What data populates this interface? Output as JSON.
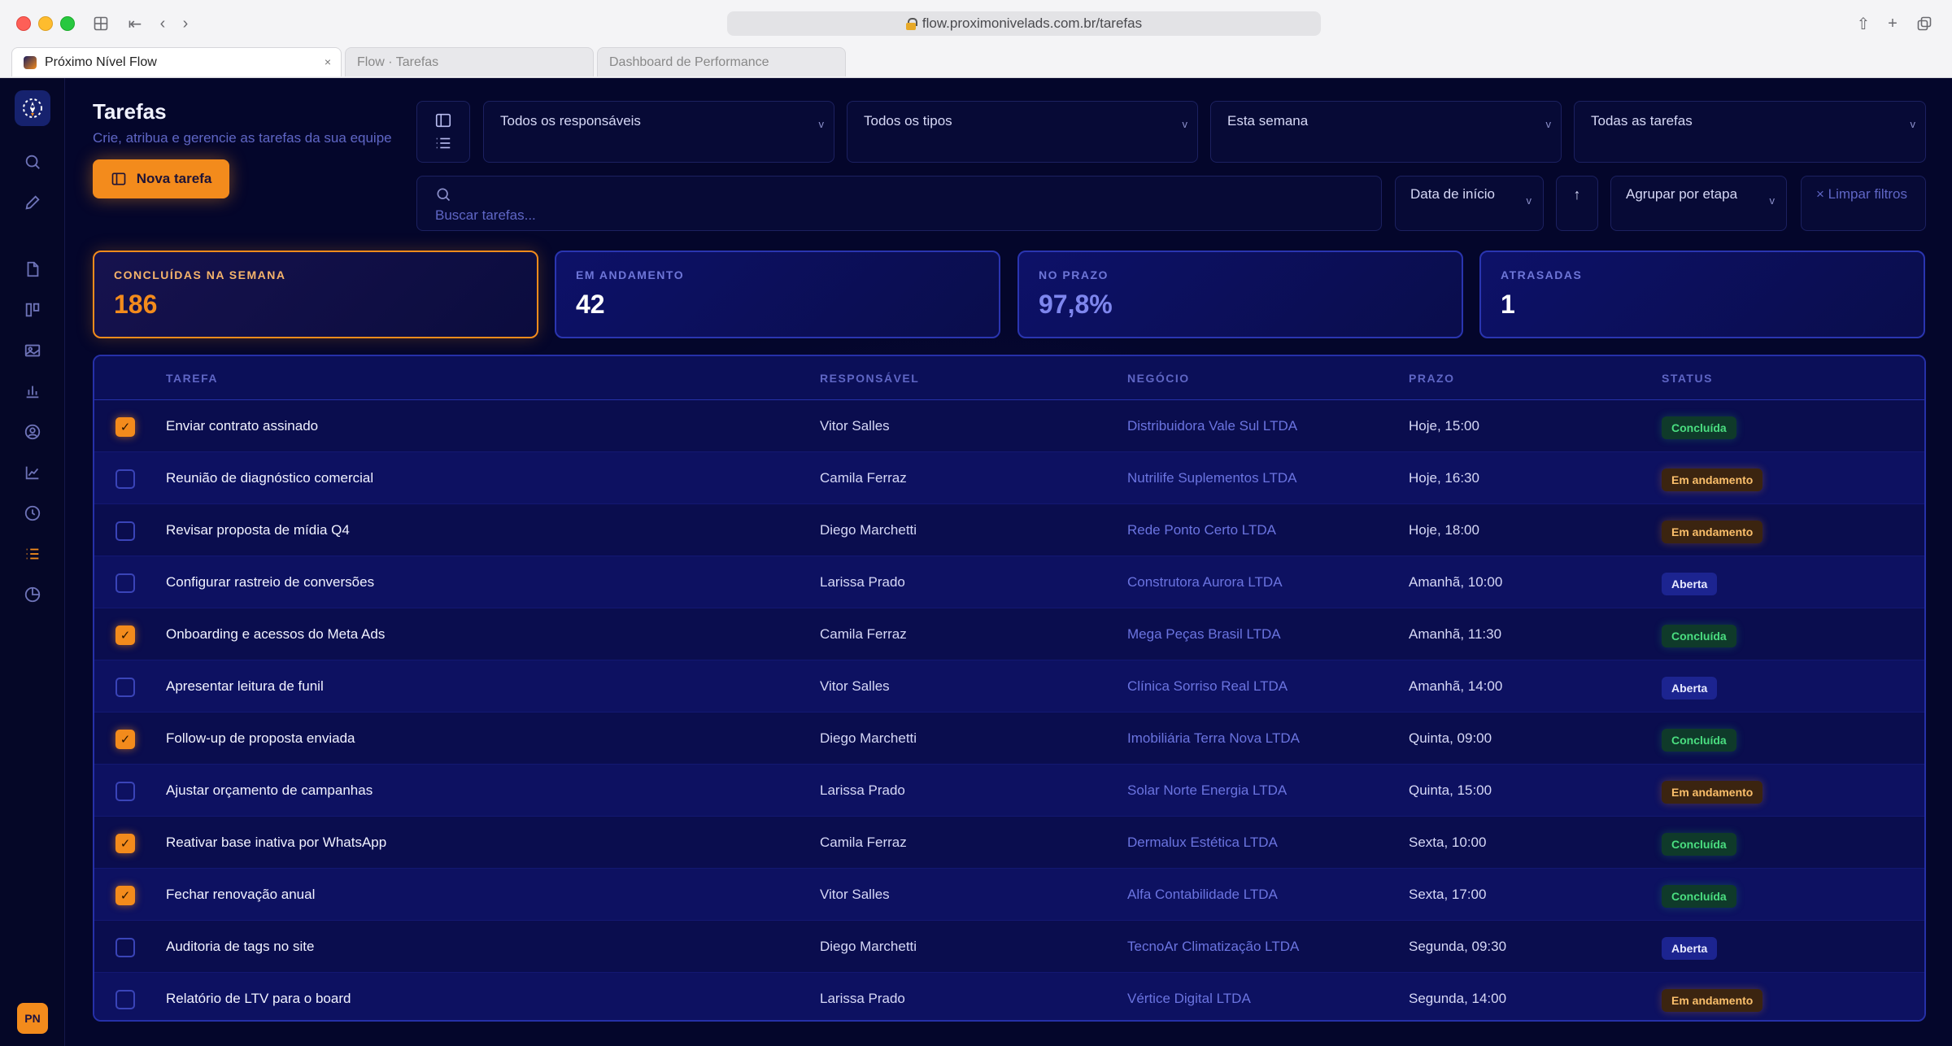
{
  "browser": {
    "url": "flow.proximonivelads.com.br/tarefas",
    "tabs": [
      {
        "label": "Próximo Nível Flow",
        "active": true
      },
      {
        "label": "Flow · Tarefas",
        "active": false
      },
      {
        "label": "Dashboard de Performance",
        "active": false
      }
    ]
  },
  "sidebar": {
    "items": [
      {
        "icon": "search-icon"
      },
      {
        "icon": "edit-icon"
      },
      {
        "icon": "file-icon"
      },
      {
        "icon": "board-icon"
      },
      {
        "icon": "image-icon"
      },
      {
        "icon": "bar-chart-icon"
      },
      {
        "icon": "user-circle-icon"
      },
      {
        "icon": "line-chart-icon"
      },
      {
        "icon": "clock-icon"
      },
      {
        "icon": "list-icon",
        "active": true
      },
      {
        "icon": "pie-chart-icon"
      }
    ],
    "avatar": "PN"
  },
  "header": {
    "title": "Tarefas",
    "subtitle": "Crie, atribua e gerencie as tarefas da sua equipe",
    "new_button": "Nova tarefa"
  },
  "filters": {
    "owner": "Todos os responsáveis",
    "type": "Todos os tipos",
    "period": "Esta semana",
    "scope": "Todas as tarefas",
    "search_placeholder": "Buscar tarefas...",
    "sort_by": "Data de início",
    "sort_dir": "↑",
    "group_by": "Agrupar por etapa",
    "clear": "× Limpar filtros"
  },
  "stats": [
    {
      "label": "CONCLUÍDAS NA SEMANA",
      "value": "186"
    },
    {
      "label": "EM ANDAMENTO",
      "value": "42"
    },
    {
      "label": "NO PRAZO",
      "value": "97,8%"
    },
    {
      "label": "ATRASADAS",
      "value": "1"
    }
  ],
  "table": {
    "columns": [
      "TAREFA",
      "RESPONSÁVEL",
      "NEGÓCIO",
      "PRAZO",
      "STATUS"
    ],
    "rows": [
      {
        "done": true,
        "task": "Enviar contrato assinado",
        "owner": "Vitor Salles",
        "business": "Distribuidora Vale Sul LTDA",
        "due": "Hoje, 15:00",
        "status": "Concluída",
        "kind": "done"
      },
      {
        "done": false,
        "task": "Reunião de diagnóstico comercial",
        "owner": "Camila Ferraz",
        "business": "Nutrilife Suplementos LTDA",
        "due": "Hoje, 16:30",
        "status": "Em andamento",
        "kind": "prog"
      },
      {
        "done": false,
        "task": "Revisar proposta de mídia Q4",
        "owner": "Diego Marchetti",
        "business": "Rede Ponto Certo LTDA",
        "due": "Hoje, 18:00",
        "status": "Em andamento",
        "kind": "prog"
      },
      {
        "done": false,
        "task": "Configurar rastreio de conversões",
        "owner": "Larissa Prado",
        "business": "Construtora Aurora LTDA",
        "due": "Amanhã, 10:00",
        "status": "Aberta",
        "kind": "open"
      },
      {
        "done": true,
        "task": "Onboarding e acessos do Meta Ads",
        "owner": "Camila Ferraz",
        "business": "Mega Peças Brasil LTDA",
        "due": "Amanhã, 11:30",
        "status": "Concluída",
        "kind": "done"
      },
      {
        "done": false,
        "task": "Apresentar leitura de funil",
        "owner": "Vitor Salles",
        "business": "Clínica Sorriso Real LTDA",
        "due": "Amanhã, 14:00",
        "status": "Aberta",
        "kind": "open"
      },
      {
        "done": true,
        "task": "Follow-up de proposta enviada",
        "owner": "Diego Marchetti",
        "business": "Imobiliária Terra Nova LTDA",
        "due": "Quinta, 09:00",
        "status": "Concluída",
        "kind": "done"
      },
      {
        "done": false,
        "task": "Ajustar orçamento de campanhas",
        "owner": "Larissa Prado",
        "business": "Solar Norte Energia LTDA",
        "due": "Quinta, 15:00",
        "status": "Em andamento",
        "kind": "prog"
      },
      {
        "done": true,
        "task": "Reativar base inativa por WhatsApp",
        "owner": "Camila Ferraz",
        "business": "Dermalux Estética LTDA",
        "due": "Sexta, 10:00",
        "status": "Concluída",
        "kind": "done"
      },
      {
        "done": true,
        "task": "Fechar renovação anual",
        "owner": "Vitor Salles",
        "business": "Alfa Contabilidade LTDA",
        "due": "Sexta, 17:00",
        "status": "Concluída",
        "kind": "done"
      },
      {
        "done": false,
        "task": "Auditoria de tags no site",
        "owner": "Diego Marchetti",
        "business": "TecnoAr Climatização LTDA",
        "due": "Segunda, 09:30",
        "status": "Aberta",
        "kind": "open"
      },
      {
        "done": false,
        "task": "Relatório de LTV para o board",
        "owner": "Larissa Prado",
        "business": "Vértice Digital LTDA",
        "due": "Segunda, 14:00",
        "status": "Em andamento",
        "kind": "prog"
      }
    ]
  },
  "colors": {
    "accent": "#f38b1c",
    "background": "#04062b",
    "panel": "#0a0d4e",
    "status_done": "#4ade80",
    "status_progress": "#fbbf6b",
    "status_open": "#1c2490"
  }
}
